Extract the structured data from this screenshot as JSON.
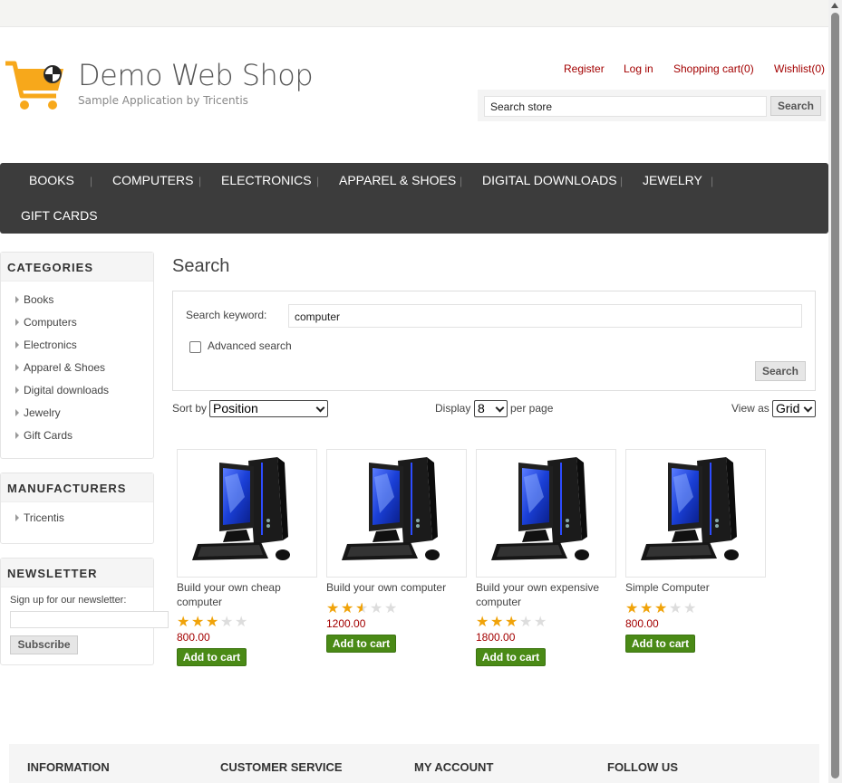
{
  "header": {
    "title": "Demo Web Shop",
    "subtitle": "Sample Application by Tricentis",
    "links": {
      "register": "Register",
      "login": "Log in",
      "cart": "Shopping cart(0)",
      "wishlist": "Wishlist(0)"
    },
    "search": {
      "value": "Search store",
      "button": "Search"
    }
  },
  "topmenu": [
    "BOOKS",
    "COMPUTERS",
    "ELECTRONICS",
    "APPAREL & SHOES",
    "DIGITAL DOWNLOADS",
    "JEWELRY",
    "GIFT CARDS"
  ],
  "sidebar": {
    "categories": {
      "title": "CATEGORIES",
      "items": [
        "Books",
        "Computers",
        "Electronics",
        "Apparel & Shoes",
        "Digital downloads",
        "Jewelry",
        "Gift Cards"
      ]
    },
    "manufacturers": {
      "title": "MANUFACTURERS",
      "items": [
        "Tricentis"
      ]
    },
    "newsletter": {
      "title": "NEWSLETTER",
      "label": "Sign up for our newsletter:",
      "button": "Subscribe"
    }
  },
  "main": {
    "title": "Search",
    "keyword_label": "Search keyword:",
    "keyword_value": "computer",
    "advanced_label": "Advanced search",
    "search_button": "Search",
    "sort_label": "Sort by",
    "sort_value": "Position",
    "display_label": "Display",
    "display_value": "8",
    "per_page_label": "per page",
    "view_label": "View as",
    "view_value": "Grid"
  },
  "products": [
    {
      "title": "Build your own cheap computer",
      "price": "800.00",
      "rating": 3,
      "button": "Add to cart"
    },
    {
      "title": "Build your own computer",
      "price": "1200.00",
      "rating": 2.5,
      "button": "Add to cart"
    },
    {
      "title": "Build your own expensive computer",
      "price": "1800.00",
      "rating": 3,
      "button": "Add to cart"
    },
    {
      "title": "Simple Computer",
      "price": "800.00",
      "rating": 3,
      "button": "Add to cart"
    }
  ],
  "footer": [
    "INFORMATION",
    "CUSTOMER SERVICE",
    "MY ACCOUNT",
    "FOLLOW US"
  ],
  "colors": {
    "accent": "#a30000",
    "menu_bg": "#3c3c3c",
    "cart_green": "#4a8a16",
    "logo_orange": "#f7a81b"
  }
}
